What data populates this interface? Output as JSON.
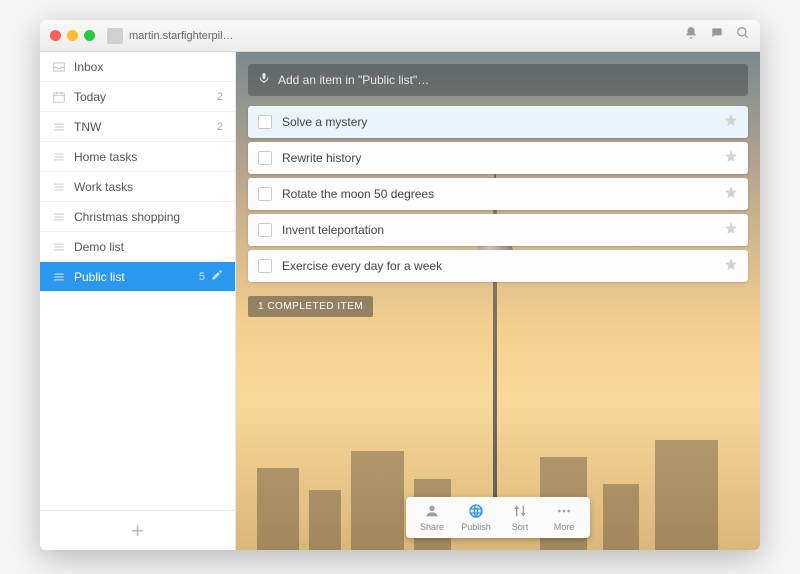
{
  "header": {
    "username": "martin.starfighterpil…"
  },
  "sidebar": {
    "items": [
      {
        "label": "Inbox",
        "count": "",
        "icon": "inbox"
      },
      {
        "label": "Today",
        "count": "2",
        "icon": "calendar"
      },
      {
        "label": "TNW",
        "count": "2",
        "icon": "list"
      },
      {
        "label": "Home tasks",
        "count": "",
        "icon": "list"
      },
      {
        "label": "Work tasks",
        "count": "",
        "icon": "list"
      },
      {
        "label": "Christmas shopping",
        "count": "",
        "icon": "list"
      },
      {
        "label": "Demo list",
        "count": "",
        "icon": "list"
      },
      {
        "label": "Public list",
        "count": "5",
        "icon": "list",
        "active": true
      }
    ]
  },
  "main": {
    "add_placeholder": "Add an item in \"Public list\"…",
    "tasks": [
      {
        "title": "Solve a mystery",
        "selected": true
      },
      {
        "title": "Rewrite history"
      },
      {
        "title": "Rotate the moon 50 degrees"
      },
      {
        "title": "Invent teleportation"
      },
      {
        "title": "Exercise every day for a week"
      }
    ],
    "completed_label": "1 COMPLETED ITEM"
  },
  "toolbar": {
    "share": "Share",
    "publish": "Publish",
    "sort": "Sort",
    "more": "More"
  }
}
